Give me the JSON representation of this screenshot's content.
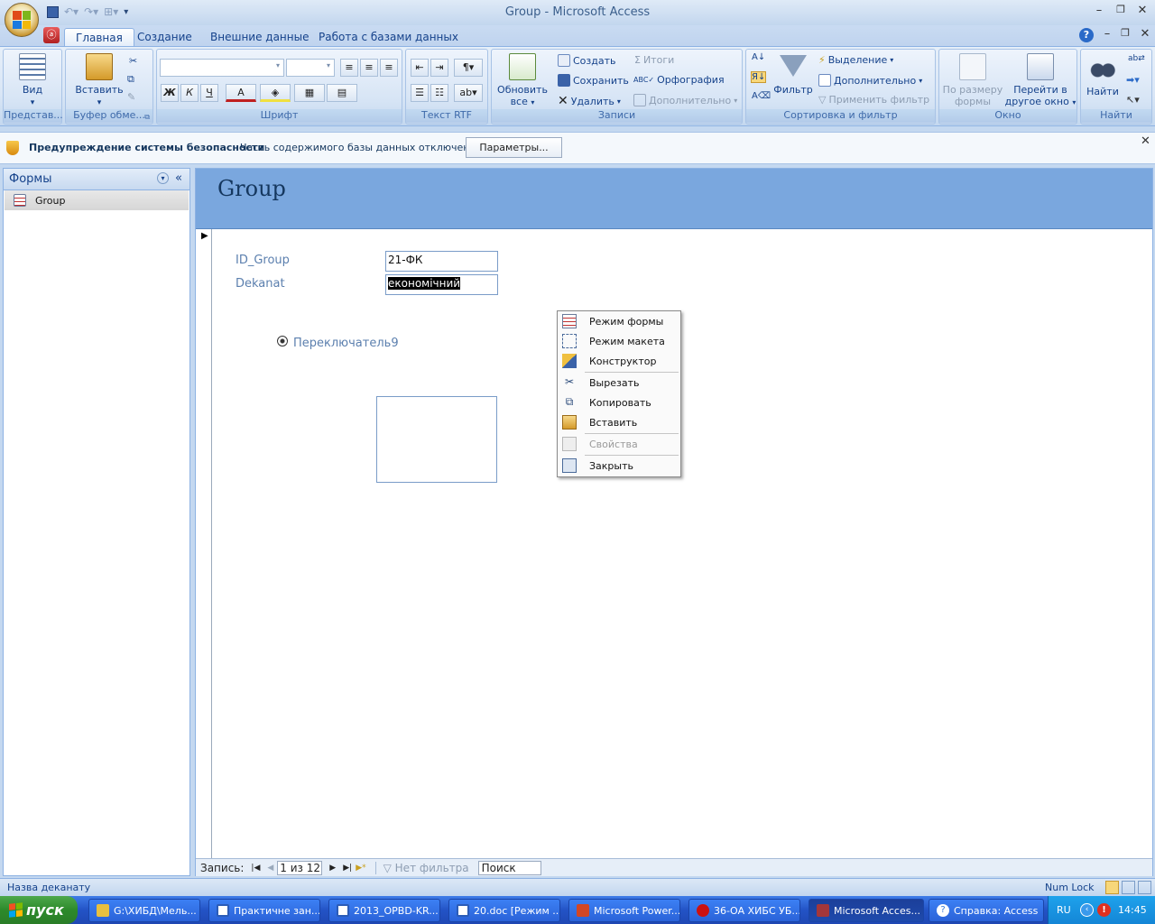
{
  "window": {
    "title": "Group - Microsoft Access"
  },
  "tabs": [
    "Главная",
    "Создание",
    "Внешние данные",
    "Работа с базами данных"
  ],
  "ribbon": {
    "views": {
      "btn": "Вид",
      "group": "Представ..."
    },
    "clipboard": {
      "paste": "Вставить",
      "group": "Буфер обме..."
    },
    "font": {
      "bold": "Ж",
      "italic": "К",
      "underline": "Ч",
      "fontcolor": "А",
      "group": "Шрифт"
    },
    "rtf": {
      "group": "Текст RTF"
    },
    "records": {
      "refresh": "Обновить все",
      "create": "Создать",
      "save": "Сохранить",
      "delete": "Удалить",
      "totals": "Итоги",
      "spelling": "Орфография",
      "more": "Дополнительно",
      "group": "Записи"
    },
    "sort": {
      "filter": "Фильтр",
      "selection": "Выделение",
      "advanced": "Дополнительно",
      "apply": "Применить фильтр",
      "group": "Сортировка и фильтр"
    },
    "window": {
      "fit": "По размеру формы",
      "switch": "Перейти в другое окно",
      "group": "Окно"
    },
    "find": {
      "find": "Найти",
      "group": "Найти"
    }
  },
  "security": {
    "title": "Предупреждение системы безопасности",
    "message": "Часть содержимого базы данных отключено",
    "button": "Параметры..."
  },
  "nav": {
    "header": "Формы",
    "items": [
      "Group"
    ]
  },
  "form": {
    "title": "Group",
    "fields": [
      {
        "label": "ID_Group",
        "value": "21-ФК"
      },
      {
        "label": "Dekanat",
        "value": "економічний"
      }
    ],
    "option_label": "Переключатель9"
  },
  "context_menu": {
    "items": [
      "Режим формы",
      "Режим макета",
      "Конструктор",
      "Вырезать",
      "Копировать",
      "Вставить",
      "Свойства",
      "Закрыть"
    ],
    "disabled": [
      "Свойства"
    ]
  },
  "record_nav": {
    "label": "Запись:",
    "position": "1 из 12",
    "filter": "Нет фильтра",
    "search": "Поиск"
  },
  "status": {
    "left": "Назва деканату",
    "numlock": "Num Lock"
  },
  "taskbar": {
    "start": "пуск",
    "tasks": [
      {
        "label": "G:\\ХИБД\\Мель...",
        "color": "#e8c040",
        "active": false
      },
      {
        "label": "Практичне зан...",
        "color": "#2b5cb8",
        "active": false
      },
      {
        "label": "2013_OPBD-KR...",
        "color": "#2b5cb8",
        "active": false
      },
      {
        "label": "20.doc [Режим ...",
        "color": "#2b5cb8",
        "active": false
      },
      {
        "label": "Microsoft Power...",
        "color": "#d24726",
        "active": false
      },
      {
        "label": "36-ОА ХИБС УБ...",
        "color": "#cc1111",
        "active": false
      },
      {
        "label": "Microsoft Acces...",
        "color": "#a4373a",
        "active": true
      },
      {
        "label": "Справка: Access",
        "color": "#3a7bd5",
        "active": false
      }
    ],
    "lang": "RU",
    "clock": "14:45"
  }
}
